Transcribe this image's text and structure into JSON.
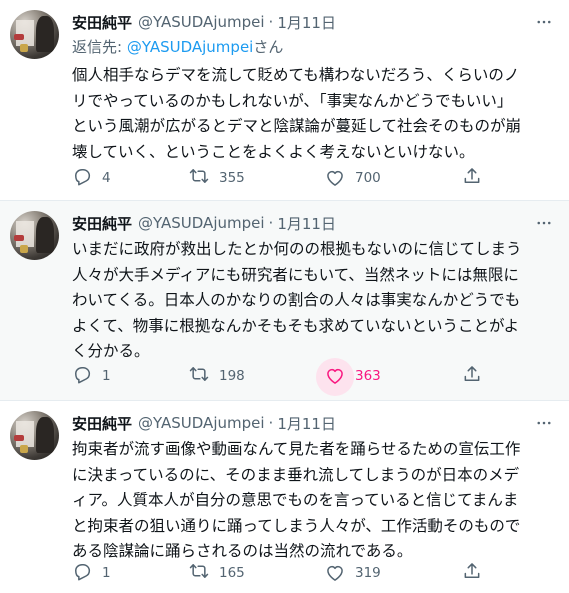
{
  "colors": {
    "accent": "#1d9bf0",
    "like": "#f91880",
    "muted": "#536471"
  },
  "tweets": [
    {
      "name": "安田純平",
      "handle": "@YASUDAjumpei",
      "dot": "·",
      "date": "1月11日",
      "reply_prefix": "返信先: ",
      "reply_handle": "@YASUDAjumpei",
      "reply_suffix": "さん",
      "lines": [
        "個人相手ならデマを流して貶めても構わないだろう、くらいのノ",
        "リでやっているのかもしれないが、「事実なんかどうでもいい」",
        "という風潮が広がるとデマと陰謀論が蔓延して社会そのものが崩",
        "壊していく、ということをよくよく考えないといけない。"
      ],
      "replies": "4",
      "retweets": "355",
      "likes": "700"
    },
    {
      "name": "安田純平",
      "handle": "@YASUDAjumpei",
      "dot": "·",
      "date": "1月11日",
      "lines": [
        "いまだに政府が救出したとか何のの根拠もないのに信じてしまう",
        "人々が大手メディアにも研究者にもいて、当然ネットには無限に",
        "わいてくる。日本人のかなりの割合の人々は事実なんかどうでも",
        "よくて、物事に根拠なんかそもそも求めていないということがよ",
        "く分かる。"
      ],
      "replies": "1",
      "retweets": "198",
      "likes": "363"
    },
    {
      "name": "安田純平",
      "handle": "@YASUDAjumpei",
      "dot": "·",
      "date": "1月11日",
      "lines": [
        "拘束者が流す画像や動画なんて見た者を踊らせるための宣伝工作",
        "に決まっているのに、そのまま垂れ流してしまうのが日本のメデ",
        "ィア。人質本人が自分の意思でものを言っていると信じてまんま",
        "と拘束者の狙い通りに踊ってしまう人々が、工作活動そのもので",
        "ある陰謀論に踊らされるのは当然の流れである。"
      ],
      "replies": "1",
      "retweets": "165",
      "likes": "319"
    }
  ],
  "icons": {
    "more": "more-horizontal-icon",
    "reply": "reply-icon",
    "retweet": "retweet-icon",
    "like": "heart-icon",
    "share": "share-icon"
  }
}
